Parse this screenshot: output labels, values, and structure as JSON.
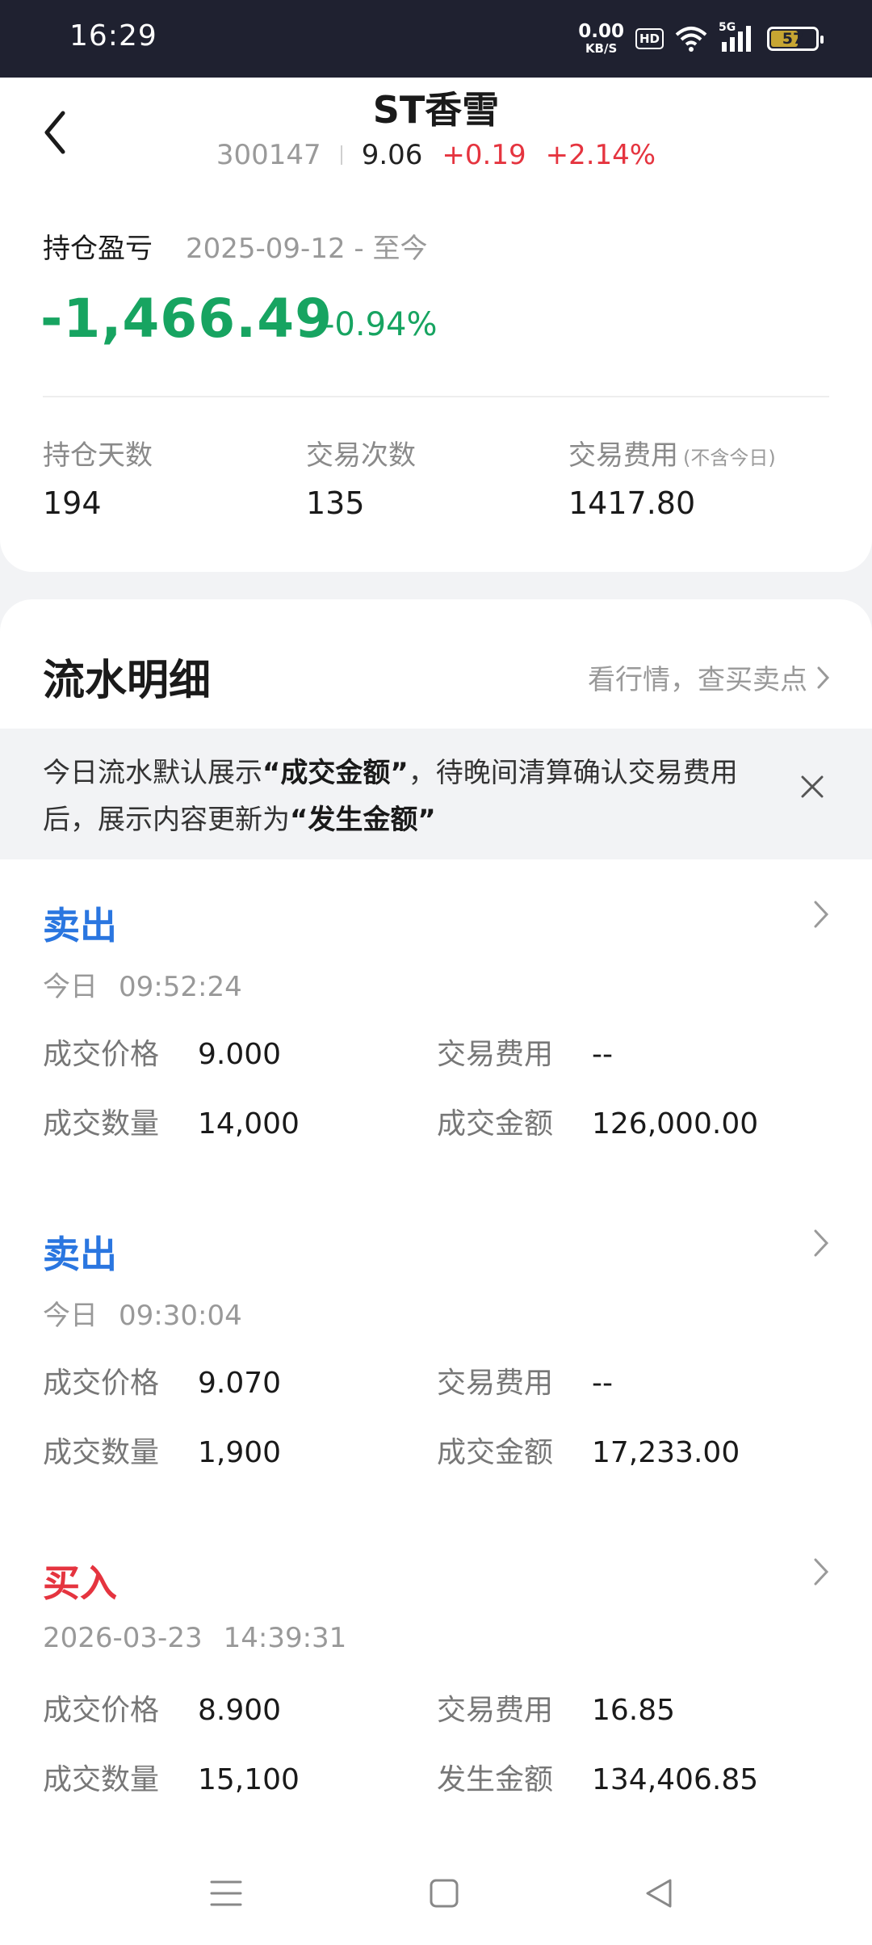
{
  "status_bar": {
    "time": "16:29",
    "net_speed": "0.00",
    "net_unit": "KB/S",
    "hd": "HD",
    "signal_label": "5G",
    "battery": "57"
  },
  "header": {
    "title": "ST香雪",
    "code": "300147",
    "price": "9.06",
    "change": "+0.19",
    "change_pct": "+2.14%"
  },
  "position": {
    "label": "持仓盈亏",
    "range": "2025-09-12 - 至今",
    "pl_value": "-1,466.49",
    "pl_pct": "-0.94%",
    "stats": [
      {
        "label": "持仓天数",
        "note": "",
        "value": "194"
      },
      {
        "label": "交易次数",
        "note": "",
        "value": "135"
      },
      {
        "label": "交易费用",
        "note": "(不含今日)",
        "value": "1417.80"
      }
    ]
  },
  "flow": {
    "title": "流水明细",
    "link": "看行情，查买卖点",
    "notice_1": "今日流水默认展示",
    "notice_b1": "“成交金额”",
    "notice_2": "，待晚间清算确认交易费用后，展示内容更新为",
    "notice_b2": "“发生金额”",
    "trades": [
      {
        "type": "卖出",
        "kind": "sell",
        "date": "今日",
        "time": "09:52:24",
        "price_label": "成交价格",
        "price": "9.000",
        "fee_label": "交易费用",
        "fee": "--",
        "qty_label": "成交数量",
        "qty": "14,000",
        "amount_label": "成交金额",
        "amount": "126,000.00"
      },
      {
        "type": "卖出",
        "kind": "sell",
        "date": "今日",
        "time": "09:30:04",
        "price_label": "成交价格",
        "price": "9.070",
        "fee_label": "交易费用",
        "fee": "--",
        "qty_label": "成交数量",
        "qty": "1,900",
        "amount_label": "成交金额",
        "amount": "17,233.00"
      },
      {
        "type": "买入",
        "kind": "buy",
        "date": "2026-03-23",
        "time": "14:39:31",
        "price_label": "成交价格",
        "price": "8.900",
        "fee_label": "交易费用",
        "fee": "16.85",
        "qty_label": "成交数量",
        "qty": "15,100",
        "amount_label": "发生金额",
        "amount": "134,406.85"
      }
    ]
  },
  "colors": {
    "loss_green": "#17a461",
    "gain_red": "#e5343f",
    "sell_blue": "#2a76e0"
  }
}
